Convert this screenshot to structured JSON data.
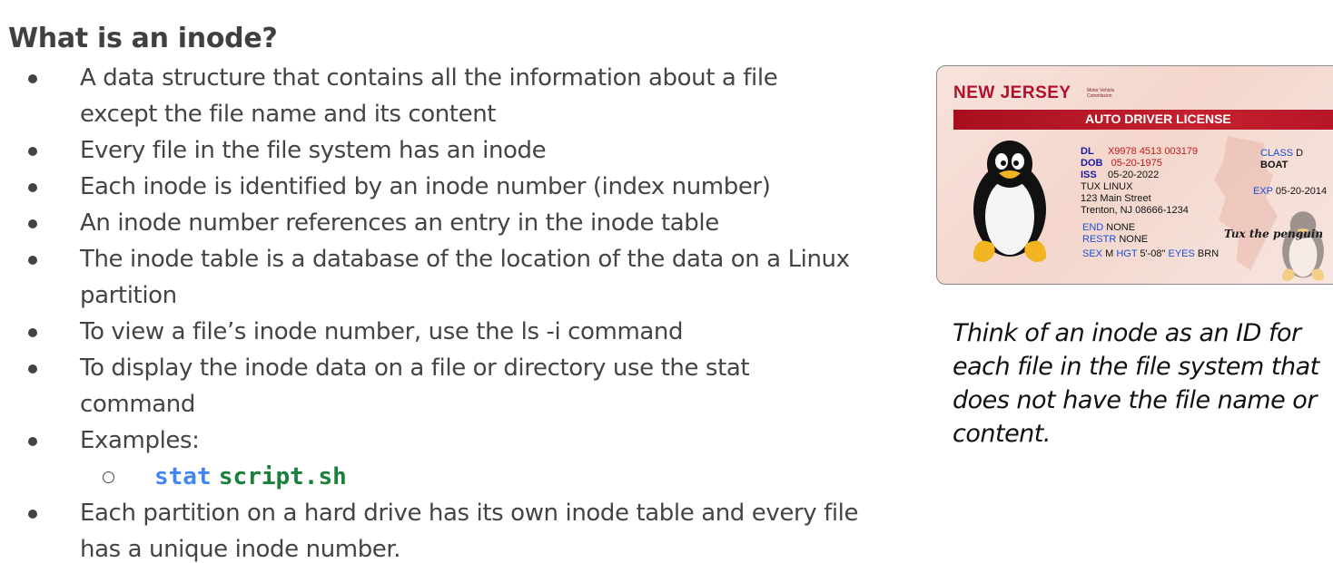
{
  "slide": {
    "title": "What is an inode?",
    "bullets": [
      "A data structure that contains all the information about a file except the file name and its content",
      "Every file in the file system has an inode",
      "Each inode is identified by an inode number (index number)",
      "An inode number references an entry in the inode table",
      "The inode table is a database of the location of the data on a Linux partition",
      "To view a file’s inode number, use the ls -i command",
      "To display the inode data on a file or directory use the stat command",
      "Examples:"
    ],
    "example": {
      "command": "stat",
      "argument": "script.sh"
    },
    "last_bullet": "Each partition on a hard drive has its own inode table and every file has a unique inode number.",
    "caption": "Think of an inode as an ID for each file in the file system that does not have the file name or content."
  },
  "license": {
    "state": "NEW JERSEY",
    "agency": "Motor Vehicle Commission",
    "banner": "AUTO DRIVER LICENSE",
    "dl_label": "DL",
    "dl": "X9978 4513 003179",
    "dob_label": "DOB",
    "dob": "05-20-1975",
    "iss_label": "ISS",
    "iss": "05-20-2022",
    "name": "TUX LINUX",
    "street": "123 Main Street",
    "city": "Trenton, NJ 08666-1234",
    "end_label": "END",
    "end": "NONE",
    "restr_label": "RESTR",
    "restr": "NONE",
    "sex_label": "SEX",
    "sex": "M",
    "hgt_label": "HGT",
    "hgt": "5'-08\"",
    "eyes_label": "EYES",
    "eyes": "BRN",
    "class_label": "CLASS",
    "class": "D",
    "class_extra": "BOAT",
    "exp_label": "EXP",
    "exp": "05-20-2014",
    "signature": "Tux the penguin"
  },
  "colors": {
    "code_command": "#4285f4",
    "code_argument": "#188038",
    "license_red": "#b0102a"
  }
}
